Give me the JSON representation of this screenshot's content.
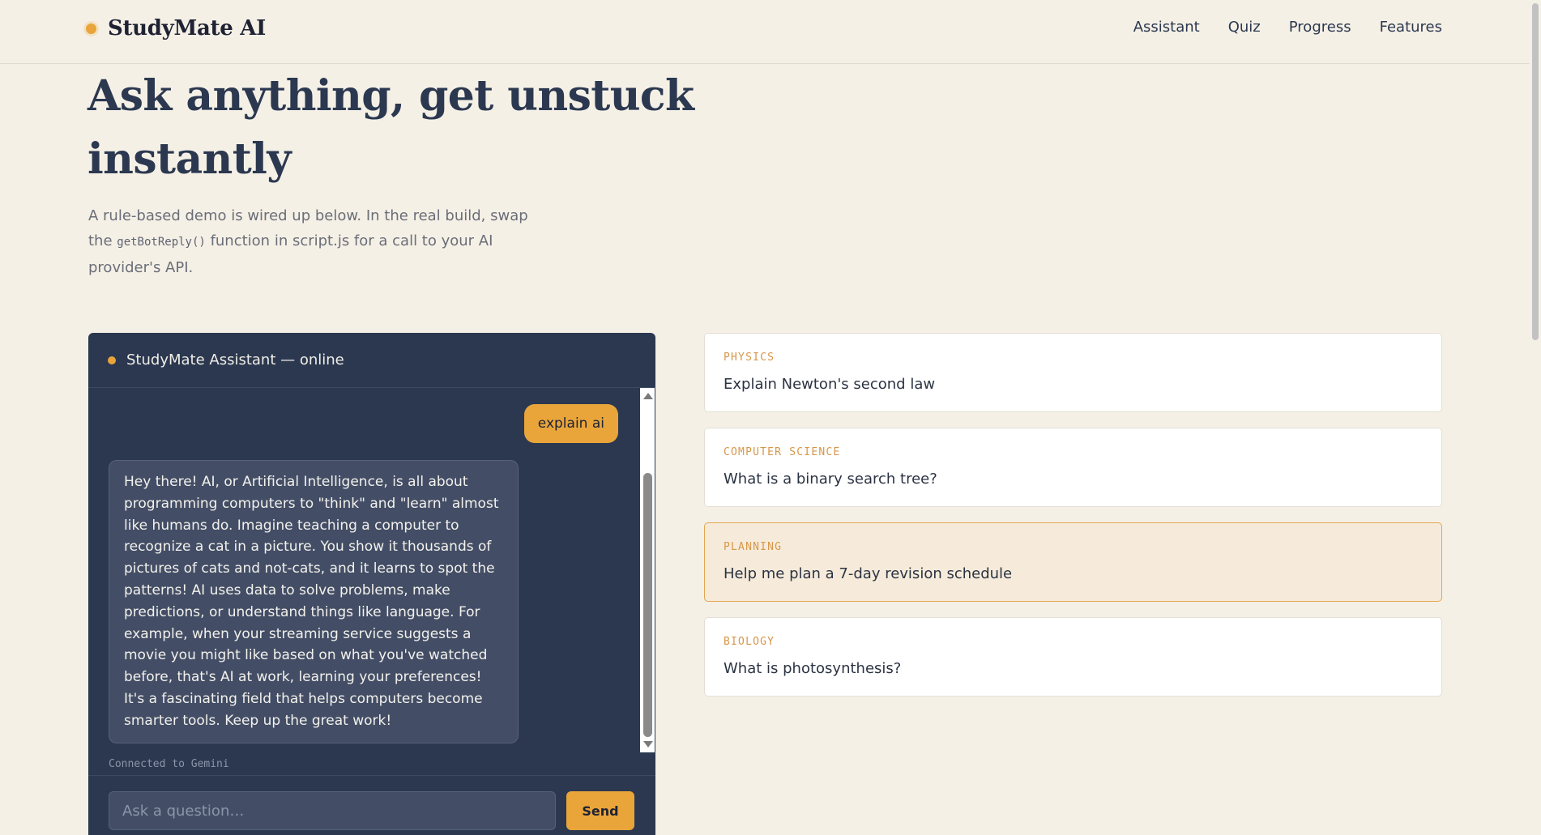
{
  "header": {
    "brand": "StudyMate AI",
    "nav": [
      "Assistant",
      "Quiz",
      "Progress",
      "Features"
    ]
  },
  "hero": {
    "title": "Ask anything, get unstuck instantly",
    "sub_before": "A rule-based demo is wired up below. In the real build, swap the ",
    "sub_code": "getBotReply()",
    "sub_after": " function in script.js for a call to your AI provider's API."
  },
  "chat": {
    "title": "StudyMate Assistant — online",
    "user_message": "explain ai",
    "bot_message": "Hey there! AI, or Artificial Intelligence, is all about programming computers to \"think\" and \"learn\" almost like humans do. Imagine teaching a computer to recognize a cat in a picture. You show it thousands of pictures of cats and not-cats, and it learns to spot the patterns! AI uses data to solve problems, make predictions, or understand things like language. For example, when your streaming service suggests a movie you might like based on what you've watched before, that's AI at work, learning your preferences! It's a fascinating field that helps computers become smarter tools. Keep up the great work!",
    "provider": "Connected to Gemini",
    "input_placeholder": "Ask a question…",
    "input_value": "",
    "send_label": "Send"
  },
  "suggestions": [
    {
      "tag": "PHYSICS",
      "question": "Explain Newton's second law"
    },
    {
      "tag": "COMPUTER SCIENCE",
      "question": "What is a binary search tree?"
    },
    {
      "tag": "PLANNING",
      "question": "Help me plan a 7-day revision schedule"
    },
    {
      "tag": "BIOLOGY",
      "question": "What is photosynthesis?"
    }
  ],
  "colors": {
    "background": "#f5f0e6",
    "panel": "#2b3850",
    "accent": "#e9a53a",
    "highlight_card": "#f6ebda"
  }
}
